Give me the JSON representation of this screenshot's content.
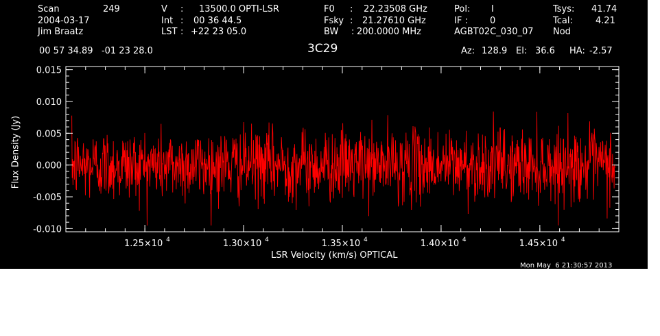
{
  "header": {
    "scan_label": "Scan",
    "scan_value": "249",
    "date": "2004-03-17",
    "observer": "Jim Braatz",
    "v_label": "V",
    "v_sep": ":",
    "v_value": "13500.0 OPTI-LSR",
    "int_label": "Int",
    "int_sep": ":",
    "int_value": "00 36 44.5",
    "lst_label": "LST",
    "lst_sep": ":",
    "lst_value": "+22 23 05.0",
    "f0_label": "F0",
    "f0_sep": ":",
    "f0_value": "22.23508 GHz",
    "fsky_label": "Fsky",
    "fsky_sep": ":",
    "fsky_value": "21.27610 GHz",
    "bw_label": "BW",
    "bw_sep": ":",
    "bw_value": "200.0000 MHz",
    "pol_label": "Pol:",
    "pol_value": "I",
    "if_label": "IF :",
    "if_value": "0",
    "project": "AGBT02C_030_07",
    "tsys_label": "Tsys:",
    "tsys_value": "41.74",
    "tcal_label": "Tcal:",
    "tcal_value": "4.21",
    "mode": "Nod",
    "coords": "00 57 34.89   -01 23 28.0",
    "source": "3C29",
    "az_label": "Az:",
    "az_value": "128.9",
    "el_label": "El:",
    "el_value": "36.6",
    "ha_label": "HA:",
    "ha_value": "-2.57"
  },
  "timestamp": "Mon May  6 21:30:57 2013",
  "colors": {
    "background": "#000000",
    "axes": "#ffffff",
    "series": "#ff0000"
  },
  "chart_data": {
    "type": "line",
    "title": "3C29",
    "xlabel": "LSR Velocity (km/s) OPTICAL",
    "ylabel": "Flux Density (Jy)",
    "xlim": [
      12100,
      14900
    ],
    "ylim": [
      -0.0105,
      0.0155
    ],
    "x_range": [
      12130,
      14880
    ],
    "x_ticks": [
      {
        "value": 12500,
        "mantissa": "1.25",
        "exp": "4"
      },
      {
        "value": 13000,
        "mantissa": "1.30",
        "exp": "4"
      },
      {
        "value": 13500,
        "mantissa": "1.35",
        "exp": "4"
      },
      {
        "value": 14000,
        "mantissa": "1.40",
        "exp": "4"
      },
      {
        "value": 14500,
        "mantissa": "1.45",
        "exp": "4"
      }
    ],
    "x_tick_base": "×10",
    "y_ticks": [
      {
        "value": -0.01,
        "label": "-0.010"
      },
      {
        "value": -0.005,
        "label": "-0.005"
      },
      {
        "value": 0.0,
        "label": "0.000"
      },
      {
        "value": 0.005,
        "label": "0.005"
      },
      {
        "value": 0.01,
        "label": "0.010"
      },
      {
        "value": 0.015,
        "label": "0.015"
      }
    ],
    "noise": {
      "mean": 0.0,
      "sigma": 0.0028,
      "min": -0.0095,
      "max": 0.0102,
      "n": 1400
    },
    "grid": false,
    "legend": "none"
  }
}
